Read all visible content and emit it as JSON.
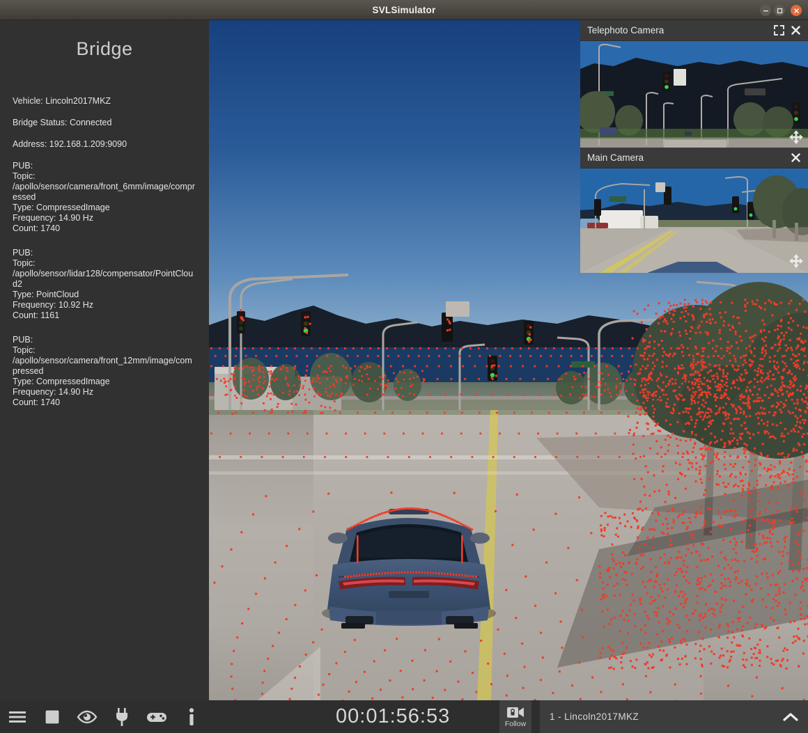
{
  "window": {
    "title": "SVLSimulator",
    "controls": {
      "minimize": "minimize-button",
      "maximize": "maximize-button",
      "close": "close-button"
    }
  },
  "sidebar": {
    "panel_title": "Bridge",
    "fields": [
      {
        "label": "Vehicle",
        "value": "Lincoln2017MKZ",
        "text": "Vehicle: Lincoln2017MKZ"
      },
      {
        "label": "Bridge Status",
        "value": "Connected",
        "text": "Bridge Status: Connected"
      },
      {
        "label": "Address",
        "value": "192.168.1.209:9090",
        "text": "Address: 192.168.1.209:9090"
      }
    ],
    "publishers": [
      {
        "header": "PUB:",
        "topic_label": "Topic:",
        "topic": "/apollo/sensor/camera/front_6mm/image/compressed",
        "type": "Type: CompressedImage",
        "frequency": "Frequency: 14.90 Hz",
        "count": "Count: 1740"
      },
      {
        "header": "PUB:",
        "topic_label": "Topic:",
        "topic": "/apollo/sensor/lidar128/compensator/PointCloud2",
        "type": "Type: PointCloud",
        "frequency": "Frequency: 10.92 Hz",
        "count": "Count: 1161"
      },
      {
        "header": "PUB:",
        "topic_label": "Topic:",
        "topic": "/apollo/sensor/camera/front_12mm/image/compressed",
        "type": "Type: CompressedImage",
        "frequency": "Frequency: 14.90 Hz",
        "count": "Count: 1740"
      }
    ]
  },
  "cameras": [
    {
      "name": "Telephoto Camera",
      "has_expand": true,
      "has_close": true,
      "has_move_handle": true
    },
    {
      "name": "Main Camera",
      "has_expand": false,
      "has_close": true,
      "has_move_handle": true
    }
  ],
  "toolbar": {
    "icons": [
      {
        "name": "menu-icon",
        "label": "Menu"
      },
      {
        "name": "stop-icon",
        "label": "Stop"
      },
      {
        "name": "eye-icon",
        "label": "Visualize"
      },
      {
        "name": "plug-icon",
        "label": "Bridge"
      },
      {
        "name": "gamepad-icon",
        "label": "Controls"
      },
      {
        "name": "info-icon",
        "label": "Info"
      }
    ],
    "timer": "00:01:56:53",
    "camera_mode": "Follow",
    "vehicle_selector": "1 - Lincoln2017MKZ",
    "expand_chevron": "chevron-up-icon"
  },
  "colors": {
    "sidebar_bg": "#313131",
    "panel_header_bg": "#3a3a3a",
    "bottom_bar_bg": "#2e2e2e",
    "vehicle_bar_bg": "#3d3d3d",
    "titlebar_bg": "#4b4741",
    "close_button": "#e36b3a",
    "text_primary": "#e4e4e4",
    "lidar_point": "#f03c28",
    "sky": "#2a5c99"
  }
}
